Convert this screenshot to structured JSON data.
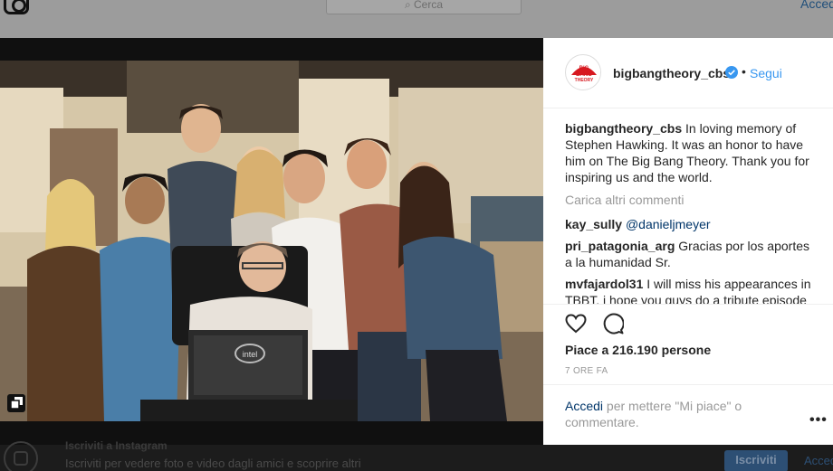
{
  "background": {
    "search_placeholder": "Cerca",
    "header_login": "Accedi",
    "footer_title": "Iscriviti a Instagram",
    "footer_text": "Iscriviti per vedere foto e video dagli amici e scoprire altri",
    "footer_signup": "Iscriviti",
    "footer_login": "Accedi"
  },
  "post": {
    "username": "bigbangtheory_cbs",
    "avatar_text": "THE BIG BANG THEORY",
    "follow_label": "Segui",
    "dot": "•",
    "caption": "In loving memory of Stephen Hawking. It was an honor to have him on The Big Bang Theory. Thank you for inspiring us and the world.",
    "load_more": "Carica altri commenti",
    "comments": [
      {
        "user": "kay_sully",
        "text": "@danieljmeyer"
      },
      {
        "user": "pri_patagonia_arg",
        "text": "Gracias por los aportes a la humanidad Sr."
      },
      {
        "user": "mvfajardol31",
        "text": "I will miss his appearances in TBBT. i hope you guys do a tribute episode"
      }
    ],
    "likes": "Piace a 216.190 persone",
    "time": "7 ORE FA",
    "login_link": "Accedi",
    "login_text": " per mettere \"Mi piace\" o commentare.",
    "more": "•••"
  },
  "colors": {
    "link": "#003569",
    "follow": "#3897f0",
    "verified": "#3897f0"
  },
  "icons": [
    "instagram-icon",
    "search-icon",
    "verified-icon",
    "heart-icon",
    "comment-icon",
    "more-icon",
    "multi-photo-icon"
  ]
}
